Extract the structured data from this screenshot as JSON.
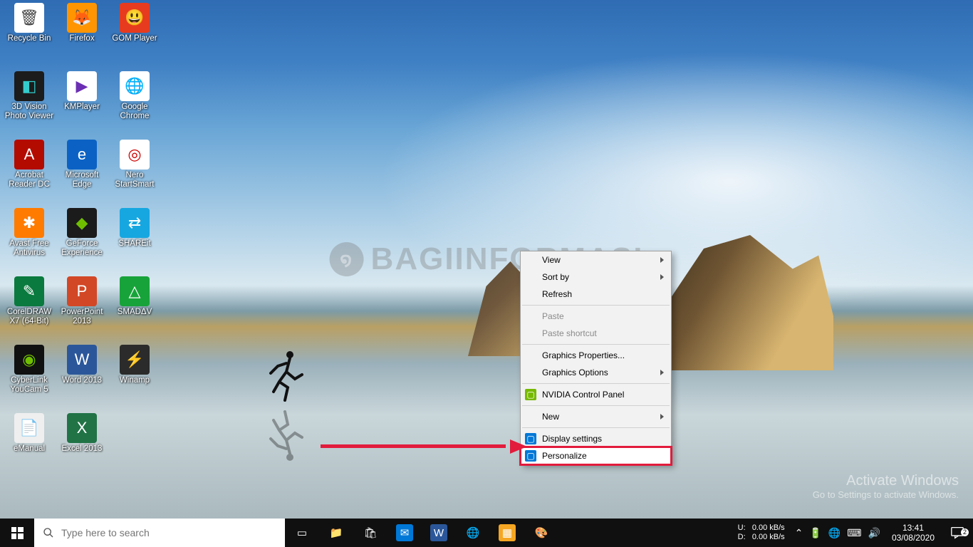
{
  "desktop_icons": [
    {
      "row": 0,
      "col": 0,
      "label": "Recycle Bin",
      "bg": "#ffffff",
      "fg": "#444",
      "glyph": "🗑"
    },
    {
      "row": 0,
      "col": 1,
      "label": "Firefox",
      "bg": "#ff9500",
      "fg": "#fff",
      "glyph": "🦊"
    },
    {
      "row": 0,
      "col": 2,
      "label": "GOM Player",
      "bg": "#e63b1f",
      "fg": "#fff",
      "glyph": "😃"
    },
    {
      "row": 1,
      "col": 0,
      "label": "3D Vision Photo Viewer",
      "bg": "#1c1c1c",
      "fg": "#3cc",
      "glyph": "◧"
    },
    {
      "row": 1,
      "col": 1,
      "label": "KMPlayer",
      "bg": "#ffffff",
      "fg": "#6b2fb3",
      "glyph": "▶"
    },
    {
      "row": 1,
      "col": 2,
      "label": "Google Chrome",
      "bg": "#ffffff",
      "fg": "#333",
      "glyph": "🌐"
    },
    {
      "row": 2,
      "col": 0,
      "label": "Acrobat Reader DC",
      "bg": "#b30b00",
      "fg": "#fff",
      "glyph": "A"
    },
    {
      "row": 2,
      "col": 1,
      "label": "Microsoft Edge",
      "bg": "#0b62c4",
      "fg": "#fff",
      "glyph": "e"
    },
    {
      "row": 2,
      "col": 2,
      "label": "Nero StartSmart",
      "bg": "#ffffff",
      "fg": "#c00",
      "glyph": "◎"
    },
    {
      "row": 3,
      "col": 0,
      "label": "Avast Free Antivirus",
      "bg": "#ff7b00",
      "fg": "#fff",
      "glyph": "✱"
    },
    {
      "row": 3,
      "col": 1,
      "label": "GeForce Experience",
      "bg": "#1b1b1b",
      "fg": "#6fbf00",
      "glyph": "◆"
    },
    {
      "row": 3,
      "col": 2,
      "label": "SHAREit",
      "bg": "#17a7e0",
      "fg": "#fff",
      "glyph": "⇄"
    },
    {
      "row": 4,
      "col": 0,
      "label": "CorelDRAW X7 (64-Bit)",
      "bg": "#0a7a3e",
      "fg": "#fff",
      "glyph": "✎"
    },
    {
      "row": 4,
      "col": 1,
      "label": "PowerPoint 2013",
      "bg": "#d24726",
      "fg": "#fff",
      "glyph": "P"
    },
    {
      "row": 4,
      "col": 2,
      "label": "SMADΔV",
      "bg": "#18a33a",
      "fg": "#fff",
      "glyph": "△"
    },
    {
      "row": 5,
      "col": 0,
      "label": "CyberLink YouCam 5",
      "bg": "#111",
      "fg": "#6fbf00",
      "glyph": "◉"
    },
    {
      "row": 5,
      "col": 1,
      "label": "Word 2013",
      "bg": "#2b579a",
      "fg": "#fff",
      "glyph": "W"
    },
    {
      "row": 5,
      "col": 2,
      "label": "Winamp",
      "bg": "#2b2b2b",
      "fg": "#f8c030",
      "glyph": "⚡"
    },
    {
      "row": 6,
      "col": 0,
      "label": "eManual",
      "bg": "#efefef",
      "fg": "#777",
      "glyph": "📄"
    },
    {
      "row": 6,
      "col": 1,
      "label": "Excel 2013",
      "bg": "#217346",
      "fg": "#fff",
      "glyph": "X"
    }
  ],
  "context_menu": {
    "items": [
      {
        "label": "View",
        "submenu": true
      },
      {
        "label": "Sort by",
        "submenu": true
      },
      {
        "label": "Refresh"
      },
      {
        "sep": true
      },
      {
        "label": "Paste",
        "disabled": true
      },
      {
        "label": "Paste shortcut",
        "disabled": true
      },
      {
        "sep": true
      },
      {
        "label": "Graphics Properties..."
      },
      {
        "label": "Graphics Options",
        "submenu": true
      },
      {
        "sep": true
      },
      {
        "label": "NVIDIA Control Panel",
        "icon": "nvidia",
        "icon_bg": "#76b900"
      },
      {
        "sep": true
      },
      {
        "label": "New",
        "submenu": true
      },
      {
        "sep": true
      },
      {
        "label": "Display settings",
        "icon": "display",
        "icon_bg": "#0078d7"
      },
      {
        "label": "Personalize",
        "icon": "personalize",
        "icon_bg": "#0078d7",
        "highlight": true
      }
    ]
  },
  "watermark": {
    "title": "Activate Windows",
    "subtitle": "Go to Settings to activate Windows."
  },
  "center_watermark": "BAGIINFORMASI",
  "taskbar": {
    "search_placeholder": "Type here to search",
    "pinned": [
      {
        "name": "task-view",
        "glyph": "▭",
        "bg": "transparent",
        "fg": "#fff"
      },
      {
        "name": "file-explorer",
        "glyph": "📁",
        "bg": "transparent"
      },
      {
        "name": "microsoft-store",
        "glyph": "🛍",
        "bg": "transparent"
      },
      {
        "name": "mail",
        "glyph": "✉",
        "bg": "#0078d7"
      },
      {
        "name": "word",
        "glyph": "W",
        "bg": "#2b579a"
      },
      {
        "name": "chrome",
        "glyph": "🌐",
        "bg": "transparent"
      },
      {
        "name": "media-player-classic",
        "glyph": "▦",
        "bg": "#f5a623"
      },
      {
        "name": "paint",
        "glyph": "🎨",
        "bg": "transparent"
      }
    ],
    "net": {
      "up_label": "U:",
      "up_value": "0.00 kB/s",
      "down_label": "D:",
      "down_value": "0.00 kB/s"
    },
    "clock": {
      "time": "13:41",
      "date": "03/08/2020"
    },
    "action_center_badge": "2"
  }
}
